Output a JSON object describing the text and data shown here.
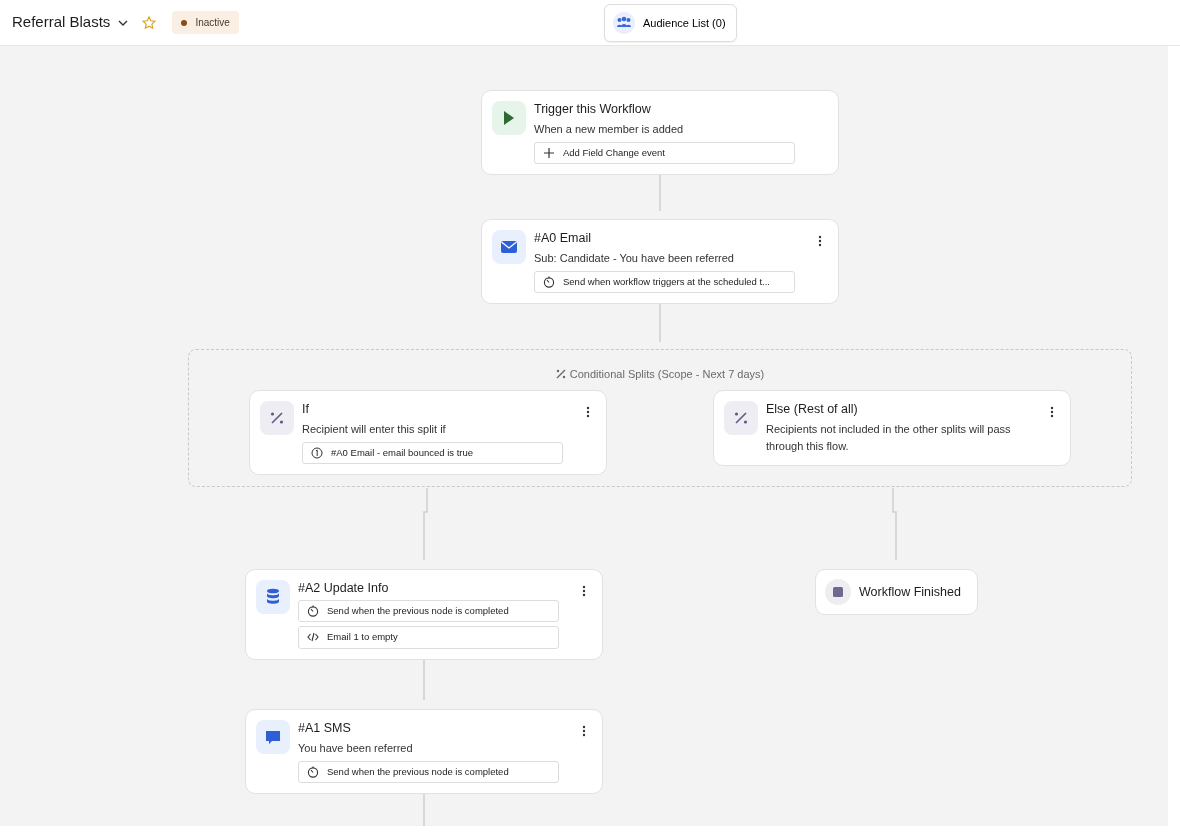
{
  "header": {
    "title": "Referral Blasts",
    "status": "Inactive",
    "audience_button": "Audience List (0)"
  },
  "nodes": [
    {
      "kind": "trigger",
      "title": "Trigger this Workflow",
      "subtitle": "When a new member is added",
      "chips": [
        {
          "kind": "add",
          "label": "Add Field Change event"
        }
      ]
    },
    {
      "kind": "email",
      "title": "#A0 Email",
      "subtitle": "Sub: Candidate - You have been referred",
      "chips": [
        {
          "kind": "schedule",
          "label": "Send when workflow triggers at the scheduled t..."
        }
      ]
    },
    {
      "kind": "split",
      "title": "Conditional Splits (Scope - Next 7 days)",
      "branches": [
        {
          "kind": "condition",
          "title": "If",
          "subtitle": "Recipient will enter this split if",
          "chips": [
            {
              "kind": "rule",
              "label": "#A0 Email - email bounced is true"
            }
          ]
        },
        {
          "kind": "condition",
          "title": "Else (Rest of all)",
          "subtitle": "Recipients not included in the other splits will pass through this flow."
        }
      ]
    },
    {
      "kind": "update",
      "title": "#A2 Update Info",
      "chips": [
        {
          "kind": "schedule",
          "label": "Send when the previous node is completed"
        },
        {
          "kind": "code",
          "label": "Email 1 to empty"
        }
      ]
    },
    {
      "kind": "finished",
      "title": "Workflow Finished"
    },
    {
      "kind": "sms",
      "title": "#A1 SMS",
      "subtitle": "You have been referred",
      "chips": [
        {
          "kind": "schedule",
          "label": "Send when the previous node is completed"
        }
      ]
    }
  ]
}
